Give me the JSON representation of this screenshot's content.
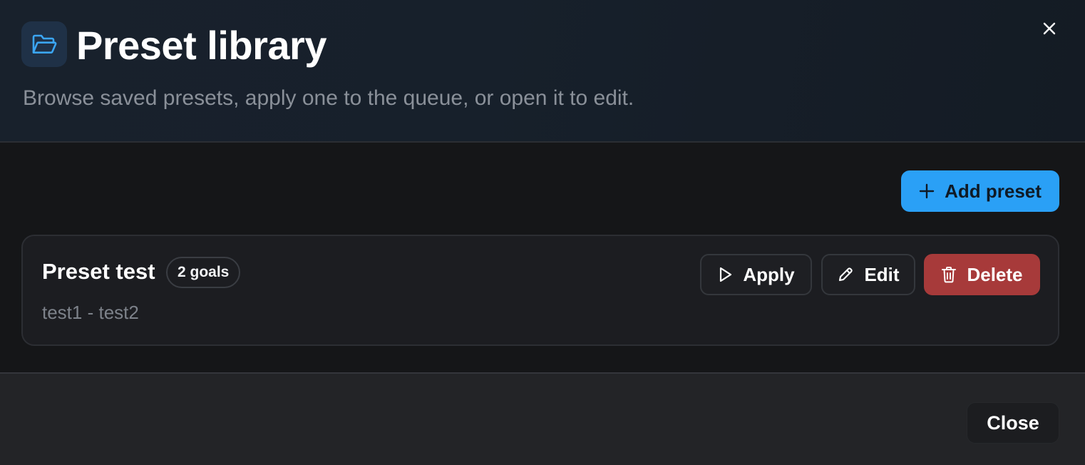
{
  "dialog": {
    "title": "Preset library",
    "subtitle": "Browse saved presets, apply one to the queue, or open it to edit.",
    "header_icon": "folder-open-icon",
    "close_icon": "close-icon"
  },
  "toolbar": {
    "add_label": "Add preset",
    "add_icon": "plus-icon"
  },
  "presets": [
    {
      "name": "Preset test",
      "goals_badge": "2 goals",
      "goals_list": "test1 - test2",
      "actions": {
        "apply_label": "Apply",
        "apply_icon": "play-icon",
        "edit_label": "Edit",
        "edit_icon": "pencil-icon",
        "delete_label": "Delete",
        "delete_icon": "trash-icon"
      }
    }
  ],
  "footer": {
    "close_label": "Close"
  },
  "colors": {
    "accent": "#2aa0f6",
    "danger": "#a73a3a",
    "background": "#151618"
  }
}
